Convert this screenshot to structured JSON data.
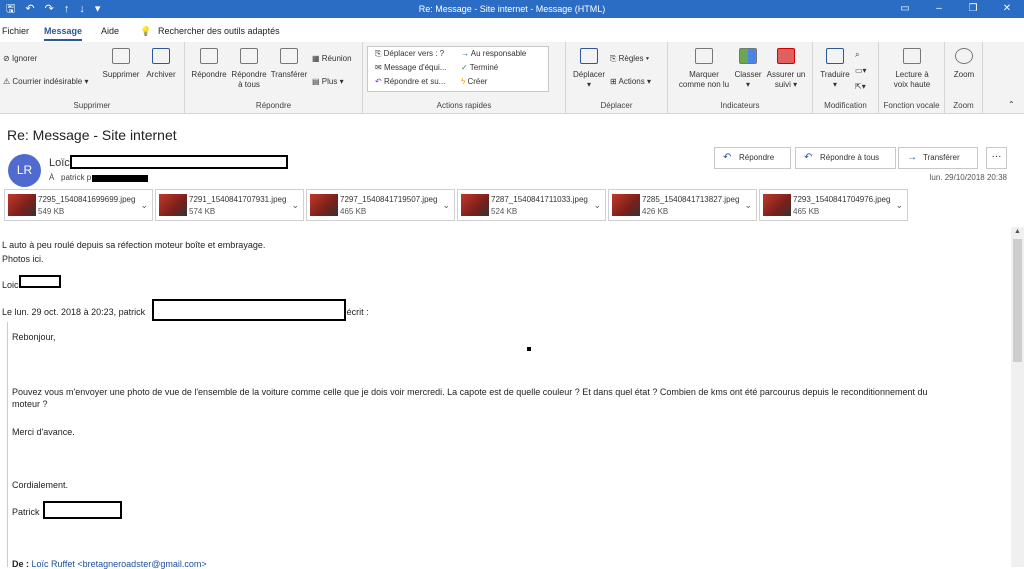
{
  "window": {
    "title": "Re: Message - Site internet - Message (HTML)",
    "quick_access": [
      "save-icon",
      "undo-icon",
      "redo-icon",
      "up-icon",
      "down-icon",
      "customize-icon"
    ],
    "controls": [
      "▭",
      "–",
      "❐",
      "✕"
    ]
  },
  "tabs": [
    {
      "label": "Fichier"
    },
    {
      "label": "Message"
    },
    {
      "label": "Aide"
    }
  ],
  "search_hint": "Rechercher des outils adaptés",
  "ribbon": {
    "supprimer": {
      "ignorer": "Ignorer",
      "courrier": "Courrier indésirable",
      "supprimer": "Supprimer",
      "archiver": "Archiver",
      "label": "Supprimer"
    },
    "repondre": {
      "repondre": "Répondre",
      "repondre_tous_1": "Répondre",
      "repondre_tous_2": "à tous",
      "transferer": "Transférer",
      "reunion": "Réunion",
      "plus": "Plus",
      "label": "Répondre"
    },
    "actions_rapides": {
      "items": [
        "Déplacer vers : ?",
        "Au responsable",
        "Message d'équi...",
        "Terminé",
        "Répondre et su...",
        "Créer"
      ],
      "label": "Actions rapides"
    },
    "deplacer": {
      "deplacer": "Déplacer",
      "regles": "Règles",
      "actions": "Actions",
      "label": "Déplacer"
    },
    "indicateurs": {
      "marquer_1": "Marquer",
      "marquer_2": "comme non lu",
      "classer": "Classer",
      "assurer_1": "Assurer un",
      "assurer_2": "suivi",
      "label": "Indicateurs"
    },
    "modification": {
      "traduire": "Traduire",
      "label": "Modification"
    },
    "fonction_vocale": {
      "lecture_1": "Lecture à",
      "lecture_2": "voix haute",
      "label": "Fonction vocale"
    },
    "zoom": {
      "zoom": "Zoom",
      "label": "Zoom"
    }
  },
  "message": {
    "subject": "Re: Message - Site internet",
    "avatar_initials": "LR",
    "sender_name": "Loïc",
    "recipient_prefix": "À",
    "recipient_name": "patrick p",
    "date": "lun. 29/10/2018 20:38",
    "actions": [
      "Répondre",
      "Répondre à tous",
      "Transférer"
    ],
    "more": "···"
  },
  "attachments": [
    {
      "name": "7295_1540841699699.jpeg",
      "size": "549 KB"
    },
    {
      "name": "7291_1540841707931.jpeg",
      "size": "574 KB"
    },
    {
      "name": "7297_1540841719507.jpeg",
      "size": "465 KB"
    },
    {
      "name": "7287_1540841711033.jpeg",
      "size": "524 KB"
    },
    {
      "name": "7285_1540841713827.jpeg",
      "size": "426 KB"
    },
    {
      "name": "7293_1540841704976.jpeg",
      "size": "465 KB"
    }
  ],
  "body": {
    "line1": "L auto à peu roulé depuis sa réfection moteur boîte et embrayage.",
    "line2": "Photos ici.",
    "signature": "Loic",
    "quote_header_1": "Le lun. 29 oct. 2018 à 20:23, patrick",
    "quote_header_2": "a écrit :",
    "q_greeting": "Rebonjour,",
    "q_para1": "Pouvez vous m'envoyer une photo de vue de l'ensemble de la voiture comme celle que je dois voir mercredi. La capote est de quelle couleur ? Et dans quel état ? Combien de kms ont été parcourus depuis le reconditionnement du",
    "q_para1b": "moteur ?",
    "q_thanks": "Merci d'avance.",
    "q_closing": "Cordialement.",
    "q_name": "Patrick",
    "q_from_label": "De :",
    "q_from_value": "Loïc Ruffet <bretagneroadster@gmail.com>"
  }
}
